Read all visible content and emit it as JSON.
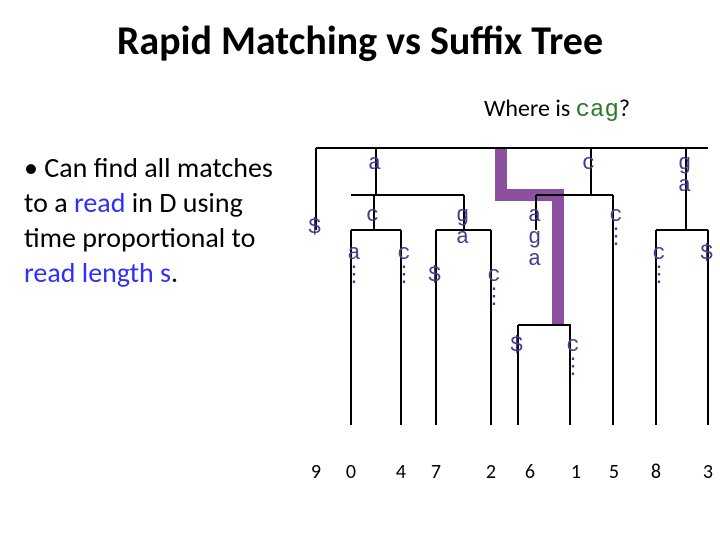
{
  "title": "Rapid Matching vs Suffix Tree",
  "query": {
    "prefix": "Where is ",
    "pattern": "cag",
    "suffix": "?"
  },
  "bullet": {
    "glyph": "• ",
    "line1": "Can find all matches to a ",
    "readWord": "read",
    "line2": " in D using time proportional to ",
    "readLen": "read length ",
    "sSym": "s",
    "dot": "."
  },
  "tree": {
    "dollar": "$",
    "top": {
      "a": "a",
      "c": "c",
      "ga": "g\na"
    },
    "a": {
      "c": "c",
      "g": "g\na",
      "c_a": "a\n⋮",
      "c_c": "c\n⋮",
      "g_c": "c\n⋮"
    },
    "c": {
      "a": "a\ng\na",
      "c": "c\n⋮",
      "a_c": "c\n⋮"
    },
    "g": {
      "c": "c\n⋮"
    },
    "leaves": [
      "9",
      "0",
      "4",
      "7",
      "2",
      "6",
      "1",
      "5",
      "8",
      "3"
    ]
  }
}
